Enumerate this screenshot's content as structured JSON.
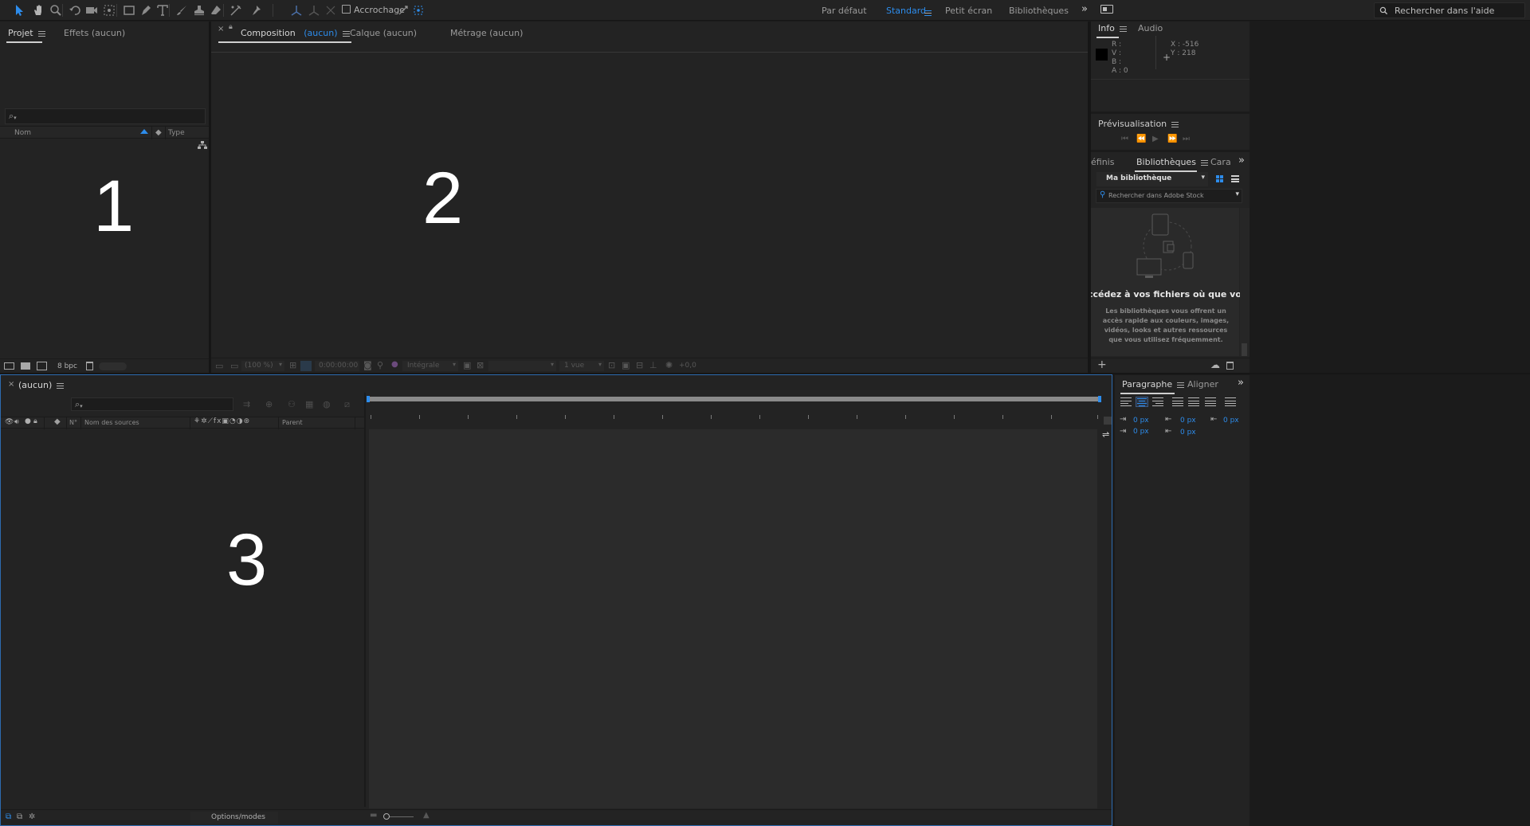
{
  "toolbar": {
    "snapping_label": "Accrochage",
    "workspaces": [
      "Par défaut",
      "Standard",
      "Petit écran",
      "Bibliothèques"
    ],
    "active_workspace": "Standard",
    "help_search_placeholder": "Rechercher dans l'aide",
    "accent_color": "#2d8ceb"
  },
  "project_panel": {
    "tabs": [
      "Projet",
      "Effets (aucun)"
    ],
    "columns": {
      "name": "Nom",
      "type": "Type"
    },
    "big_label": "1",
    "footer": {
      "bpc": "8 bpc"
    }
  },
  "composition_panel": {
    "tabs": [
      "Composition",
      "(aucun)",
      "Calque (aucun)",
      "Métrage (aucun)"
    ],
    "big_label": "2",
    "footer": {
      "zoom": "(100 %)",
      "timecode": "0:00:00:00",
      "resolution": "Intégrale",
      "views": "1 vue",
      "exposure": "+0,0"
    }
  },
  "info_panel": {
    "tabs": [
      "Info",
      "Audio"
    ],
    "r": "R :",
    "v": "V :",
    "b": "B :",
    "a": "A : 0",
    "x": "X : -516",
    "y": "Y : 218"
  },
  "preview_panel": {
    "title": "Prévisualisation"
  },
  "libraries_panel": {
    "tabs": [
      "éfinis",
      "Bibliothèques",
      "Cara"
    ],
    "library_name": "Ma bibliothèque",
    "stock_search_placeholder": "Rechercher dans Adobe Stock",
    "headline": "ccédez à vos fichiers où que vous soyez",
    "description": "Les bibliothèques vous offrent un accès rapide aux couleurs, images, vidéos, looks et autres ressources que vous utilisez fréquemment."
  },
  "timeline_panel": {
    "tab": "(aucun)",
    "columns": {
      "number": "N°",
      "source_name": "Nom des sources",
      "parent": "Parent"
    },
    "big_label": "3",
    "footer_toggle": "Options/modes"
  },
  "paragraph_panel": {
    "tabs": [
      "Paragraphe",
      "Aligner"
    ],
    "indent_left": "0 px",
    "indent_first": "0 px",
    "indent_right": "0 px",
    "space_before": "0 px",
    "space_after": "0 px"
  }
}
